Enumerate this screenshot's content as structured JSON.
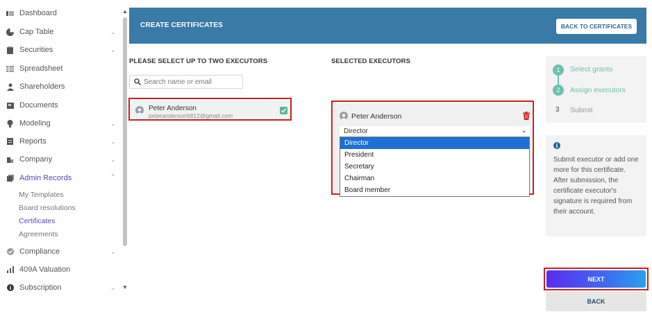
{
  "sidebar": {
    "items": [
      {
        "label": "Dashboard",
        "icon": "dashboard-icon"
      },
      {
        "label": "Cap Table",
        "icon": "pie-chart-icon"
      },
      {
        "label": "Securities",
        "icon": "clipboard-icon"
      },
      {
        "label": "Spreadsheet",
        "icon": "spreadsheet-icon"
      },
      {
        "label": "Shareholders",
        "icon": "person-icon"
      },
      {
        "label": "Documents",
        "icon": "document-icon"
      },
      {
        "label": "Modeling",
        "icon": "bulb-icon"
      },
      {
        "label": "Reports",
        "icon": "report-icon"
      },
      {
        "label": "Company",
        "icon": "building-icon"
      },
      {
        "label": "Admin Records",
        "icon": "records-icon"
      },
      {
        "label": "Compliance",
        "icon": "shield-check-icon"
      },
      {
        "label": "409A Valuation",
        "icon": "bar-chart-icon"
      },
      {
        "label": "Subscription",
        "icon": "info-circle-icon"
      }
    ],
    "sub_items": [
      {
        "label": "My Templates"
      },
      {
        "label": "Board resolutions"
      },
      {
        "label": "Certificates"
      },
      {
        "label": "Agreements"
      }
    ]
  },
  "header": {
    "title": "CREATE CERTIFICATES",
    "back_label": "BACK TO CERTIFICATES"
  },
  "left_panel": {
    "title": "PLEASE SELECT UP TO TWO EXECUTORS",
    "search_placeholder": "Search name or email",
    "executor": {
      "name": "Peter Anderson",
      "email": "peteranderson5812@gmail.com",
      "checked": true
    }
  },
  "right_panel": {
    "title": "SELECTED EXECUTORS",
    "executor_name": "Peter Anderson",
    "role_selected": "Director",
    "role_options": [
      "Director",
      "President",
      "Secretary",
      "Chairman",
      "Board member"
    ]
  },
  "steps": [
    {
      "number": "1",
      "label": "Select grants",
      "state": "done"
    },
    {
      "number": "2",
      "label": "Assign executors",
      "state": "current"
    },
    {
      "number": "3",
      "label": "Submit",
      "state": "pending"
    }
  ],
  "info": {
    "icon": "info-icon",
    "text": "Submit executor or add one more for this certificate. After submission, the certificate executor's signature is required from their account."
  },
  "actions": {
    "next_label": "NEXT",
    "back_label": "BACK"
  },
  "colors": {
    "header_bg": "#3a7aa6",
    "accent_purple": "#5b3fc4",
    "step_green": "#6dc0ae",
    "highlight_red": "#d11b1b",
    "selected_option": "#1e6fd6"
  }
}
